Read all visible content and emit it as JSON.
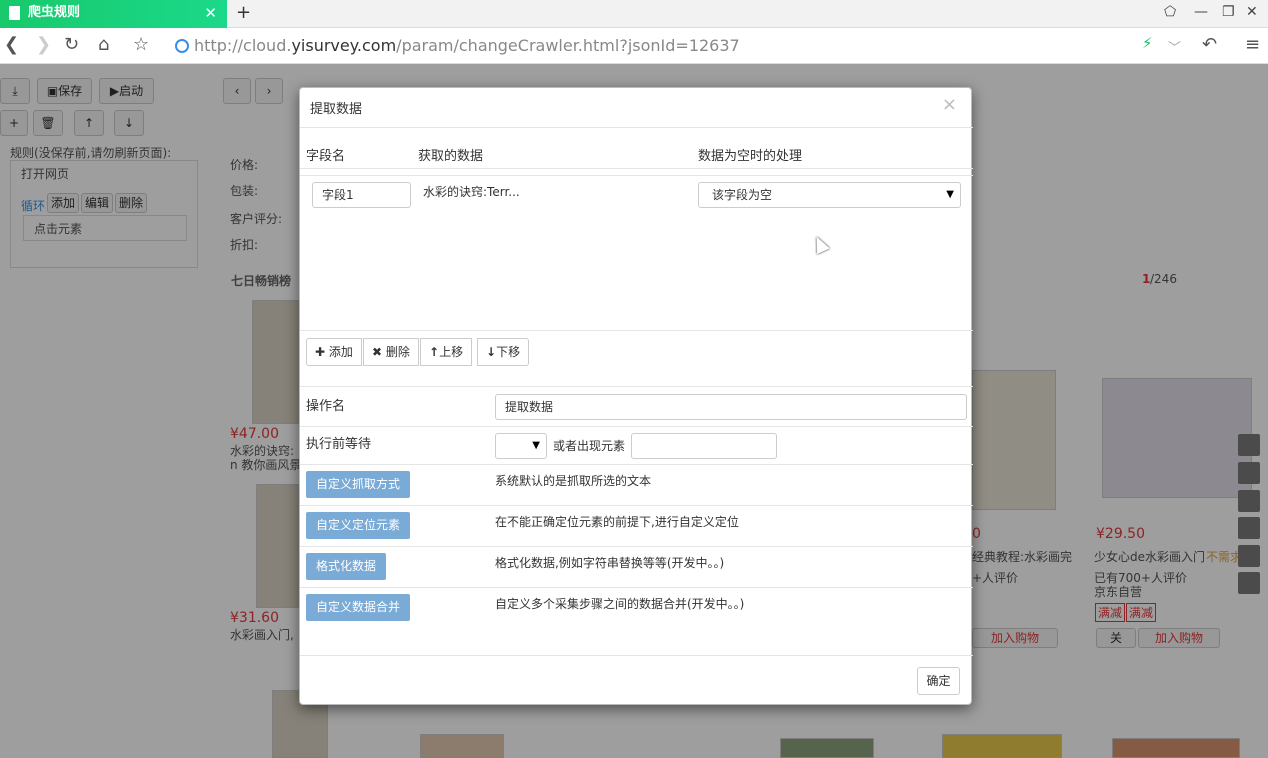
{
  "browser": {
    "tab_title": "爬虫规则",
    "tab_close": "✕",
    "new_tab": "+",
    "url_prefix": "http://cloud.",
    "url_domain": "yisurvey.com",
    "url_path": "/param/changeCrawler.html?jsonId=12637"
  },
  "bg": {
    "save": "保存",
    "start": "启动",
    "rule_label": "规则(没保存前,请勿刷新页面):",
    "open_page": "打开网页",
    "loop": "循环",
    "add": "添加",
    "edit": "编辑",
    "delete": "删除",
    "click_element": "点击元素",
    "price_label": "价格:",
    "package_label": "包装:",
    "rating_label": "客户评分:",
    "discount_label": "折扣:",
    "bestseller": "七日畅销榜",
    "page_current": "1",
    "page_total": "/246",
    "p1_price": "¥47.00",
    "p1_name": "水彩的诀窍:",
    "p1_name2": "n 教你画风景",
    "p2_price": "¥31.60",
    "p2_name": "水彩画入门,",
    "p3_price": "¥29.50",
    "p3_name": "少女心de水彩画入门",
    "p3_tag": "不需求",
    "p3_reviews": "已有700+人评价",
    "p3_shop": "京东自营",
    "p4_name": "经典教程:水彩画完",
    "p4_reviews": "+人评价",
    "p4_price": "0",
    "tag_full": "满减",
    "follow": "关",
    "add_cart": "加入购物"
  },
  "modal": {
    "title": "提取数据",
    "close": "×",
    "col_field": "字段名",
    "col_data": "获取的数据",
    "col_empty": "数据为空时的处理",
    "field_value": "字段1",
    "data_value": "水彩的诀窍:Terr...",
    "empty_select": "该字段为空",
    "btn_add": "添加",
    "btn_delete": "删除",
    "btn_up": "上移",
    "btn_down": "下移",
    "op_name_label": "操作名",
    "op_name_value": "提取数据",
    "wait_label": "执行前等待",
    "or_element": "或者出现元素",
    "btn_custom_fetch": "自定义抓取方式",
    "desc_custom_fetch": "系统默认的是抓取所选的文本",
    "btn_custom_locate": "自定义定位元素",
    "desc_custom_locate": "在不能正确定位元素的前提下,进行自定义定位",
    "btn_format": "格式化数据",
    "desc_format": "格式化数据,例如字符串替换等等(开发中。。)",
    "btn_merge": "自定义数据合并",
    "desc_merge": "自定义多个采集步骤之间的数据合并(开发中。。)",
    "ok": "确定"
  },
  "colors": {
    "tab_green": "#1bd98a",
    "blue_button": "#7aaad6",
    "price_red": "#e4393c"
  }
}
